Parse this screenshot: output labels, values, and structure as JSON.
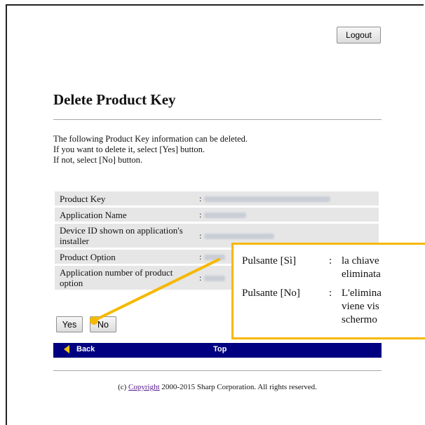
{
  "header": {
    "logout_label": "Logout"
  },
  "page": {
    "title": "Delete Product Key",
    "description": [
      "The following Product Key information can be deleted.",
      "If you want to delete it, select [Yes] button.",
      "If not, select [No] button."
    ]
  },
  "table": {
    "rows": [
      {
        "label": "Product Key"
      },
      {
        "label": "Application Name"
      },
      {
        "label": "Device ID shown on application's installer"
      },
      {
        "label": "Product Option"
      },
      {
        "label": "Application number of product option"
      }
    ]
  },
  "buttons": {
    "yes_label": "Yes",
    "no_label": "No"
  },
  "nav": {
    "back_label": "Back",
    "top_label": "Top"
  },
  "footer": {
    "prefix": "(c) ",
    "link": "Copyright",
    "suffix": " 2000-2015 Sharp Corporation. All rights reserved."
  },
  "callout": {
    "items": [
      {
        "key": "Pulsante [Sì]",
        "text_lines": [
          "la chiave",
          "eliminata"
        ]
      },
      {
        "key": "Pulsante [No]",
        "text_lines": [
          "L'elimina",
          "viene vis",
          "schermo"
        ]
      }
    ],
    "colon": ":"
  },
  "colors": {
    "nav_bg": "#000080",
    "accent": "#f5b800",
    "row_bg": "#e6e6e6"
  }
}
